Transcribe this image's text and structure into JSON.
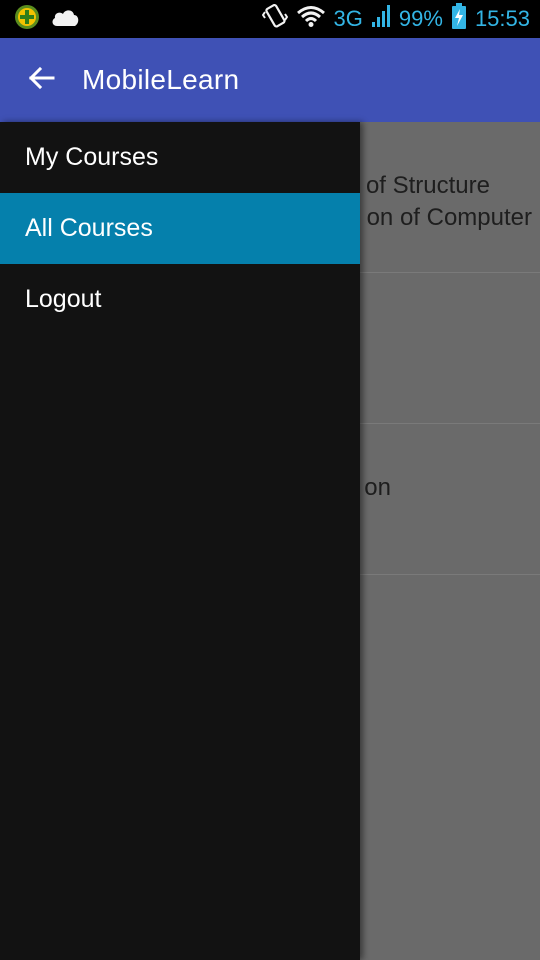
{
  "status_bar": {
    "left_icons": [
      "app-notification-icon",
      "cloud-icon"
    ],
    "network": "3G",
    "battery": "99%",
    "time": "15:53",
    "right_icons": [
      "vibrate-icon",
      "wifi-icon",
      "signal-icon",
      "battery-charging-icon"
    ]
  },
  "app_bar": {
    "back_icon": "arrow-back-icon",
    "title": "MobileLearn",
    "color": "#3f51b5"
  },
  "drawer": {
    "items": [
      {
        "label": "My Courses",
        "active": false
      },
      {
        "label": "All Courses",
        "active": true
      },
      {
        "label": "Logout",
        "active": false
      }
    ],
    "active_color": "#0580ac"
  },
  "content": {
    "visible_fragments": [
      {
        "lines": [
          "of Structure",
          "on of Computer"
        ]
      },
      {
        "lines": []
      },
      {
        "lines": [
          "on"
        ]
      }
    ]
  }
}
